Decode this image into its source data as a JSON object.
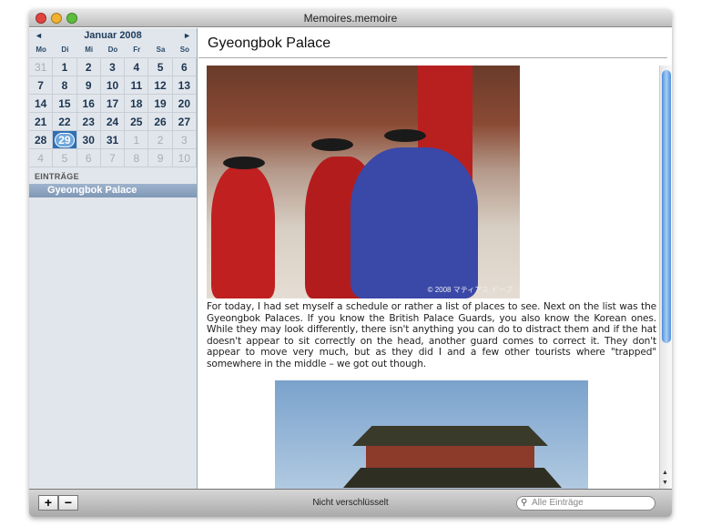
{
  "window": {
    "title": "Memoires.memoire"
  },
  "calendar": {
    "month": "Januar 2008",
    "prev": "◄",
    "next": "►",
    "weekdays": [
      "Mo",
      "Di",
      "Mi",
      "Do",
      "Fr",
      "Sa",
      "So"
    ],
    "days": [
      "31",
      "1",
      "2",
      "3",
      "4",
      "5",
      "6",
      "7",
      "8",
      "9",
      "10",
      "11",
      "12",
      "13",
      "14",
      "15",
      "16",
      "17",
      "18",
      "19",
      "20",
      "21",
      "22",
      "23",
      "24",
      "25",
      "26",
      "27",
      "28",
      "29",
      "30",
      "31",
      "1",
      "2",
      "3",
      "4",
      "5",
      "6",
      "7",
      "8",
      "9",
      "10"
    ],
    "selected": "29"
  },
  "entries": {
    "header": "EINTRÄGE",
    "items": [
      "Gyeongbok Palace"
    ]
  },
  "entry": {
    "title": "Gyeongbok Palace",
    "photo_credit": "© 2008 マティアス ドーブ",
    "body": "For today, I had set myself a schedule or rather a list of places to see. Next on the list was the Gyeongbok Palaces. If you know the British Palace Guards, you also know the Korean ones. While they may look differently, there isn't anything you can do to distract them and if the hat doesn't appear to sit correctly on the head, another guard comes to correct it. They don't appear to move very much, but as they did I and a few other tourists where \"trapped\" somewhere in the middle – we got out though."
  },
  "bottom": {
    "add": "+",
    "remove": "−",
    "status": "Nicht verschlüsselt",
    "search_placeholder": "Alle Einträge"
  }
}
